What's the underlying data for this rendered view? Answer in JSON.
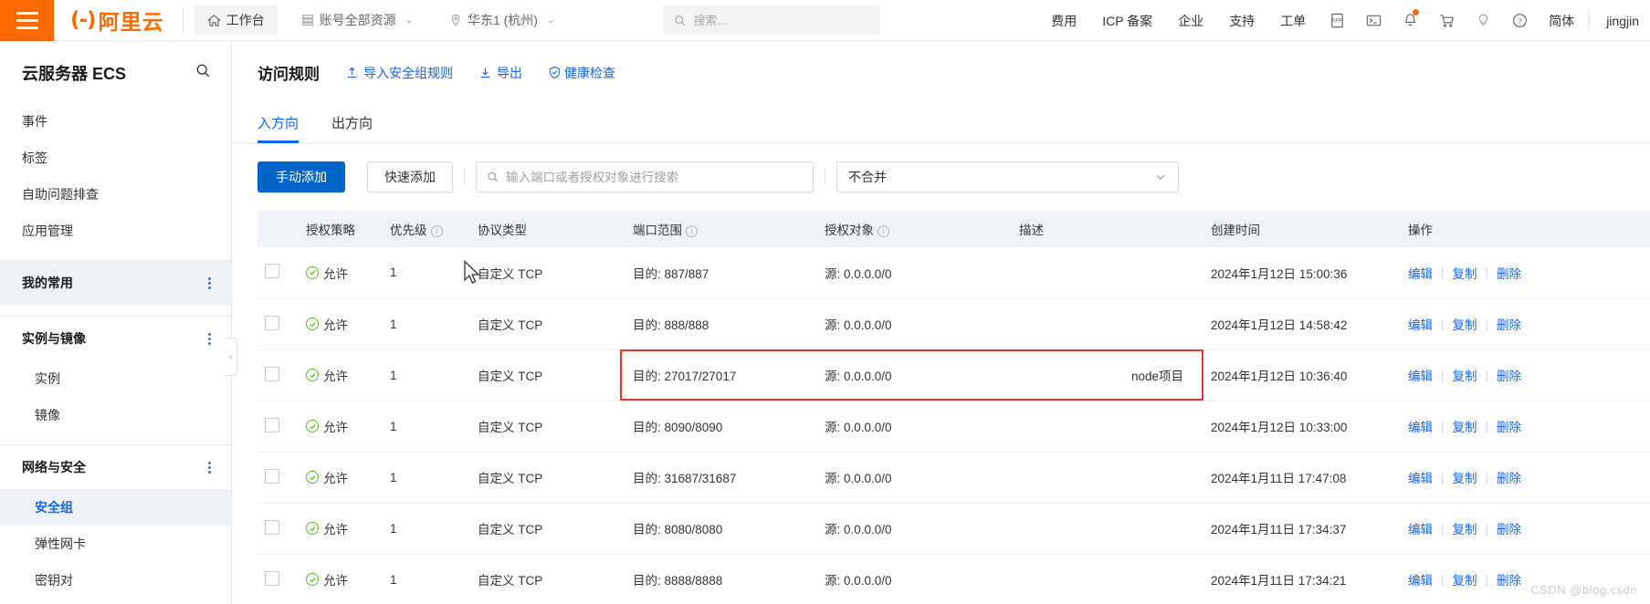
{
  "header": {
    "menu_icon": "hamburger-icon",
    "logo_text": "阿里云",
    "workbench": "工作台",
    "resources": "账号全部资源",
    "region": "华东1 (杭州)",
    "search_placeholder": "搜索...",
    "links": [
      "费用",
      "ICP 备案",
      "企业",
      "支持",
      "工单"
    ],
    "icons": [
      "app-icon",
      "terminal-icon",
      "bell-icon",
      "cart-icon",
      "lightbulb-icon",
      "help-icon"
    ],
    "language": "简体",
    "username": "jingjin"
  },
  "sidebar": {
    "product_title": "云服务器 ECS",
    "search_icon": "search-icon",
    "top_links": [
      "事件",
      "标签",
      "自助问题排查",
      "应用管理"
    ],
    "groups": [
      {
        "label": "我的常用",
        "highlighted": true,
        "items": []
      },
      {
        "label": "实例与镜像",
        "highlighted": false,
        "items": [
          {
            "label": "实例",
            "active": false
          },
          {
            "label": "镜像",
            "active": false
          }
        ]
      },
      {
        "label": "网络与安全",
        "highlighted": false,
        "items": [
          {
            "label": "安全组",
            "active": true
          },
          {
            "label": "弹性网卡",
            "active": false
          },
          {
            "label": "密钥对",
            "active": false
          }
        ]
      }
    ],
    "collapse_icon": "chevron-left-icon"
  },
  "main": {
    "page_title": "访问规则",
    "actions": [
      {
        "label": "导入安全组规则",
        "icon": "upload-icon"
      },
      {
        "label": "导出",
        "icon": "download-icon"
      },
      {
        "label": "健康检查",
        "icon": "shield-check-icon"
      }
    ],
    "tabs": [
      {
        "label": "入方向",
        "active": true
      },
      {
        "label": "出方向",
        "active": false
      }
    ],
    "toolbar": {
      "primary_button": "手动添加",
      "secondary_button": "快速添加",
      "search_placeholder": "输入端口或者授权对象进行搜索",
      "search_value": "",
      "merge_select_value": "不合并"
    },
    "table": {
      "columns": [
        {
          "label": "授权策略",
          "info": false
        },
        {
          "label": "优先级",
          "info": true
        },
        {
          "label": "协议类型",
          "info": false
        },
        {
          "label": "端口范围",
          "info": true
        },
        {
          "label": "授权对象",
          "info": true
        },
        {
          "label": "描述",
          "info": false
        },
        {
          "label": "创建时间",
          "info": false
        },
        {
          "label": "操作",
          "info": false
        }
      ],
      "action_labels": [
        "编辑",
        "复制",
        "删除"
      ],
      "rows": [
        {
          "policy": "允许",
          "priority": "1",
          "protocol": "自定义 TCP",
          "port": "目的: 887/887",
          "target": "源: 0.0.0.0/0",
          "desc": "",
          "created": "2024年1月12日 15:00:36",
          "highlighted": false
        },
        {
          "policy": "允许",
          "priority": "1",
          "protocol": "自定义 TCP",
          "port": "目的: 888/888",
          "target": "源: 0.0.0.0/0",
          "desc": "",
          "created": "2024年1月12日 14:58:42",
          "highlighted": false
        },
        {
          "policy": "允许",
          "priority": "1",
          "protocol": "自定义 TCP",
          "port": "目的: 27017/27017",
          "target": "源: 0.0.0.0/0",
          "desc": "node项目",
          "created": "2024年1月12日 10:36:40",
          "highlighted": true
        },
        {
          "policy": "允许",
          "priority": "1",
          "protocol": "自定义 TCP",
          "port": "目的: 8090/8090",
          "target": "源: 0.0.0.0/0",
          "desc": "",
          "created": "2024年1月12日 10:33:00",
          "highlighted": false
        },
        {
          "policy": "允许",
          "priority": "1",
          "protocol": "自定义 TCP",
          "port": "目的: 31687/31687",
          "target": "源: 0.0.0.0/0",
          "desc": "",
          "created": "2024年1月11日 17:47:08",
          "highlighted": false
        },
        {
          "policy": "允许",
          "priority": "1",
          "protocol": "自定义 TCP",
          "port": "目的: 8080/8080",
          "target": "源: 0.0.0.0/0",
          "desc": "",
          "created": "2024年1月11日 17:34:37",
          "highlighted": false
        },
        {
          "policy": "允许",
          "priority": "1",
          "protocol": "自定义 TCP",
          "port": "目的: 8888/8888",
          "target": "源: 0.0.0.0/0",
          "desc": "",
          "created": "2024年1月11日 17:34:21",
          "highlighted": false
        }
      ]
    },
    "watermark": "CSDN @blog.csdn"
  },
  "colors": {
    "brand_orange": "#ff6a00",
    "link_blue": "#1366ec",
    "primary_button": "#0064c8",
    "allow_green": "#52c41a",
    "highlight_red": "#e8332f"
  }
}
